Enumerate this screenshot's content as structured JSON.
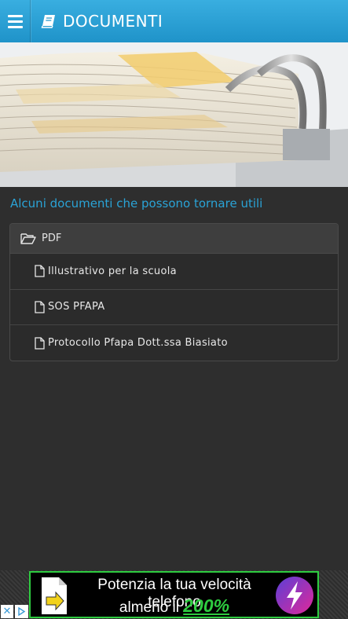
{
  "header": {
    "title": "DOCUMENTI",
    "menu_icon": "hamburger-menu-icon",
    "title_icon": "book-icon",
    "color": "#2aa3d6"
  },
  "hero": {
    "image": "stack-of-documents-binder-photo"
  },
  "main": {
    "subtitle": "Alcuni documenti che possono tornare utili",
    "panel": {
      "heading": "PDF",
      "heading_icon": "folder-open-icon",
      "items": [
        {
          "label": "Illustrativo per la scuola",
          "icon": "file-icon"
        },
        {
          "label": "SOS PFAPA",
          "icon": "file-icon"
        },
        {
          "label": "Protocollo Pfapa Dott.ssa Biasiato",
          "icon": "file-icon"
        }
      ]
    }
  },
  "ad": {
    "line1": "Potenzia la tua velocità telefono",
    "line2_prefix": "almeno il",
    "line2_highlight": "200%",
    "close_label": "✕",
    "accent": "#2ecc40"
  }
}
